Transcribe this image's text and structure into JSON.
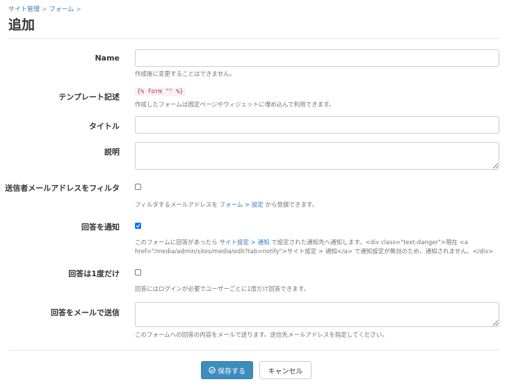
{
  "breadcrumb": {
    "items": [
      "サイト管理",
      "フォーム"
    ],
    "separator": ">"
  },
  "page_title": "追加",
  "fields": {
    "name": {
      "label": "Name",
      "value": "",
      "help": "作成後に変更することはできません。"
    },
    "template": {
      "label": "テンプレート記述",
      "code": "{% form \"\" %}",
      "help": "作成したフォームは固定ページやウィジェットに埋め込んで利用できます。"
    },
    "title": {
      "label": "タイトル",
      "value": ""
    },
    "description": {
      "label": "説明",
      "value": ""
    },
    "filter_sender": {
      "label": "送信者メールアドレスをフィルタ",
      "checked": false,
      "help_prefix": "フィルタするメールアドレスを ",
      "help_link": "フォーム > 設定",
      "help_suffix": " から登録できます。"
    },
    "notify": {
      "label": "回答を通知",
      "checked": true,
      "help_prefix": "このフォームに回答があったら ",
      "help_link": "サイト設定 > 通知",
      "help_suffix": " で設定された通知先へ通知します。<div class=\"text-danger\">現在 <a",
      "help_line2": "href=\"/media/admin/sites/media/edit?tab=notify\">サイト設定 > 通知</a> で通知設定が無効のため、通知されません。</div>"
    },
    "once": {
      "label": "回答は1度だけ",
      "checked": false,
      "help": "回答にはログインが必要でユーザーごとに1度だけ回答できます。"
    },
    "email_send": {
      "label": "回答をメールで送信",
      "value": "",
      "help": "このフォームへの回答の内容をメールで送ります。送信先メールアドレスを指定してください。"
    }
  },
  "buttons": {
    "save": "保存する",
    "cancel": "キャンセル"
  },
  "colors": {
    "primary": "#3c8dbc",
    "link": "#337ab7",
    "code_text": "#c7254e",
    "checkbox_checked": "#0075ff"
  }
}
